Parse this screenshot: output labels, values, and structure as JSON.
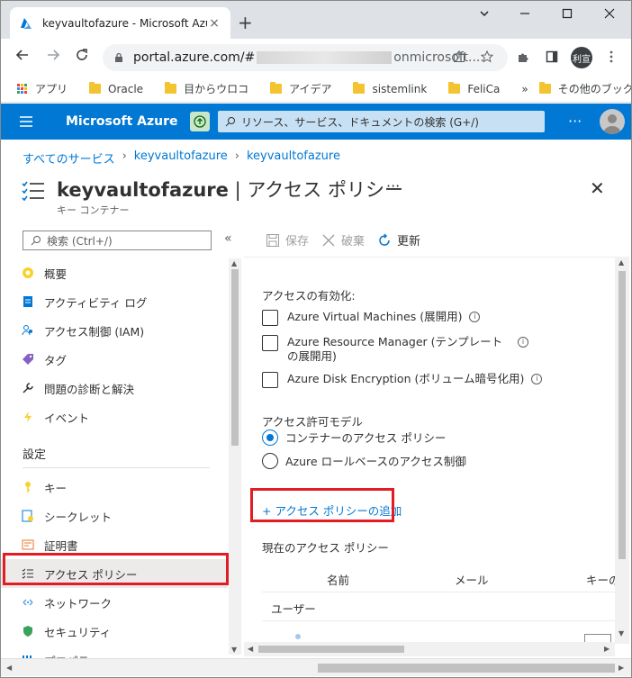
{
  "browser": {
    "tab_title": "keyvaultofazure - Microsoft Azu",
    "tab_close": "×",
    "new_tab": "+",
    "url_host": "portal.azure.com/#",
    "url_tail": "onmicrosoft....",
    "profile": "利宣",
    "bookmarks": [
      "アプリ",
      "Oracle",
      "目からウロコ",
      "アイデア",
      "sistemlink",
      "FeliCa"
    ],
    "bookmarks_more": "»",
    "other_bookmarks": "その他のブックマーク"
  },
  "azure": {
    "brand": "Microsoft Azure",
    "search_placeholder": "リソース、サービス、ドキュメントの検索 (G+/)",
    "more": "···"
  },
  "breadcrumb": [
    "すべてのサービス",
    "keyvaultofazure",
    "keyvaultofazure"
  ],
  "page": {
    "title_bold": "keyvaultofazure",
    "title_rest": " | アクセス ポリシー",
    "ellipsis": "···",
    "subtitle": "キー コンテナー",
    "close": "✕"
  },
  "leftnav": {
    "search_placeholder": "検索 (Ctrl+/)",
    "collapse": "«",
    "items_top": [
      "概要",
      "アクティビティ ログ",
      "アクセス制御 (IAM)",
      "タグ",
      "問題の診断と解決",
      "イベント"
    ],
    "section": "設定",
    "items_settings": [
      "キー",
      "シークレット",
      "証明書",
      "アクセス ポリシー",
      "ネットワーク",
      "セキュリティ",
      "プロパティ"
    ]
  },
  "commands": {
    "save": "保存",
    "discard": "破棄",
    "refresh": "更新"
  },
  "access": {
    "enable_label": "アクセスの有効化:",
    "options": [
      "Azure Virtual Machines (展開用)",
      "Azure Resource Manager (テンプレートの展開用)",
      "Azure Disk Encryption (ボリューム暗号化用)"
    ],
    "model_label": "アクセス許可モデル",
    "model_options": [
      "コンテナーのアクセス ポリシー",
      "Azure ロールベースのアクセス制御"
    ],
    "add_policy": "+ アクセス ポリシーの追加",
    "current_label": "現在のアクセス ポリシー",
    "columns": [
      "名前",
      "メール",
      "キーの"
    ],
    "group_user": "ユーザー"
  },
  "colors": {
    "azure_blue": "#0078d4",
    "highlight": "#e31b23"
  }
}
